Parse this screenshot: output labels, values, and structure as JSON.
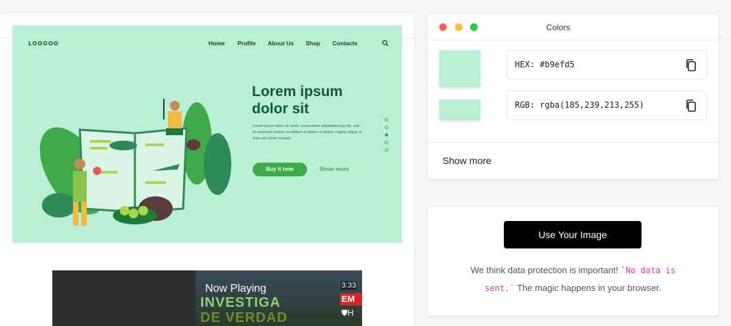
{
  "hero": {
    "logo": "LOOGOO",
    "nav": [
      {
        "label": "Home"
      },
      {
        "label": "Profile"
      },
      {
        "label": "About Us"
      },
      {
        "label": "Shop"
      },
      {
        "label": "Contacts"
      }
    ],
    "search_icon": "search-icon",
    "title_line1": "Lorem ipsum",
    "title_line2": "dolor sit",
    "body": "Lorem ipsum dolor sit amet, consectetur adipadipiscing elit, sed do eiusmod tempor incididunt ut labore et dolore magna aliqua ut enim ad minim veniam.",
    "buy_button": "Buy it now",
    "show_more_link": "Show more",
    "slider_dots": 5,
    "active_dot": 3,
    "background_color": "#b9efd5",
    "accent_color": "#3eaa4a"
  },
  "video": {
    "now_playing": "Now Playing",
    "title_line1": "INVESTIGA",
    "title_line2": "DE VERDAD",
    "duration": "3:33",
    "badge": "EM",
    "channel_letter": "H"
  },
  "colors_panel": {
    "title": "Colors",
    "hex_label": "HEX: #b9efd5",
    "rgb_label": "RGB: rgba(185,239,213,255)",
    "swatch_color": "#b9efd5",
    "copy_icon": "copy-icon",
    "show_more": "Show more",
    "window_dots": [
      "#ff5f57",
      "#febc2e",
      "#28c840"
    ]
  },
  "image_panel": {
    "button": "Use Your Image",
    "privacy_before": "We think data protection is important! ",
    "privacy_code": "`No data is sent.`",
    "privacy_after": " The magic happens in your browser."
  }
}
